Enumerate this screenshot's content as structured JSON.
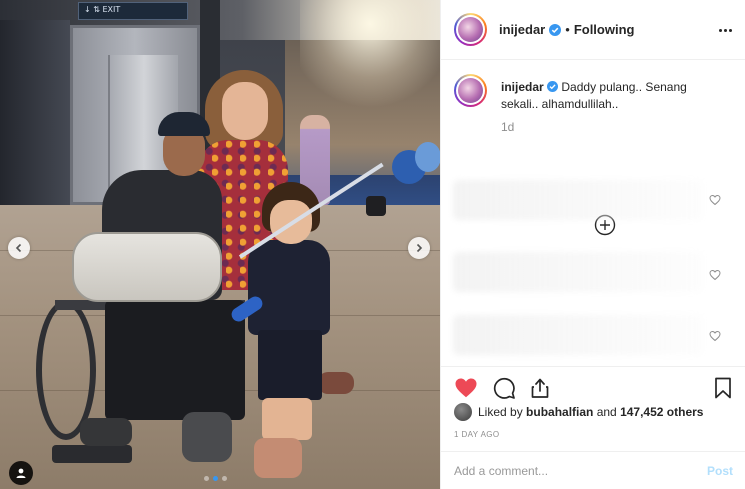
{
  "photo": {
    "sign_text": "↓ ⇅ EXIT",
    "carousel": {
      "total": 3,
      "active_index": 1
    }
  },
  "post": {
    "username": "inijedar",
    "verified": true,
    "separator": "•",
    "follow_status": "Following",
    "caption_username": "inijedar",
    "caption_text": "Daddy pulang.. Senang sekali.. alhamdullilah..",
    "caption_time": "1d",
    "liked_by_prefix": "Liked by ",
    "liked_by_user": "bubahalfian",
    "liked_by_connector": " and ",
    "liked_by_others": "147,452 others",
    "post_age": "1 DAY AGO"
  },
  "comment": {
    "placeholder": "Add a comment...",
    "post_label": "Post"
  },
  "icons": {
    "like": "heart-icon",
    "comment": "comment-icon",
    "share": "share-icon",
    "save": "bookmark-icon",
    "more": "more-options-icon",
    "load_more": "plus-circle-icon",
    "verified": "verified-badge-icon",
    "tag": "user-tag-icon"
  },
  "colors": {
    "like_red": "#ed4956",
    "verified_blue": "#3897f0",
    "post_disabled": "#b2dffc",
    "text": "#262626",
    "muted": "#8e8e8e"
  }
}
